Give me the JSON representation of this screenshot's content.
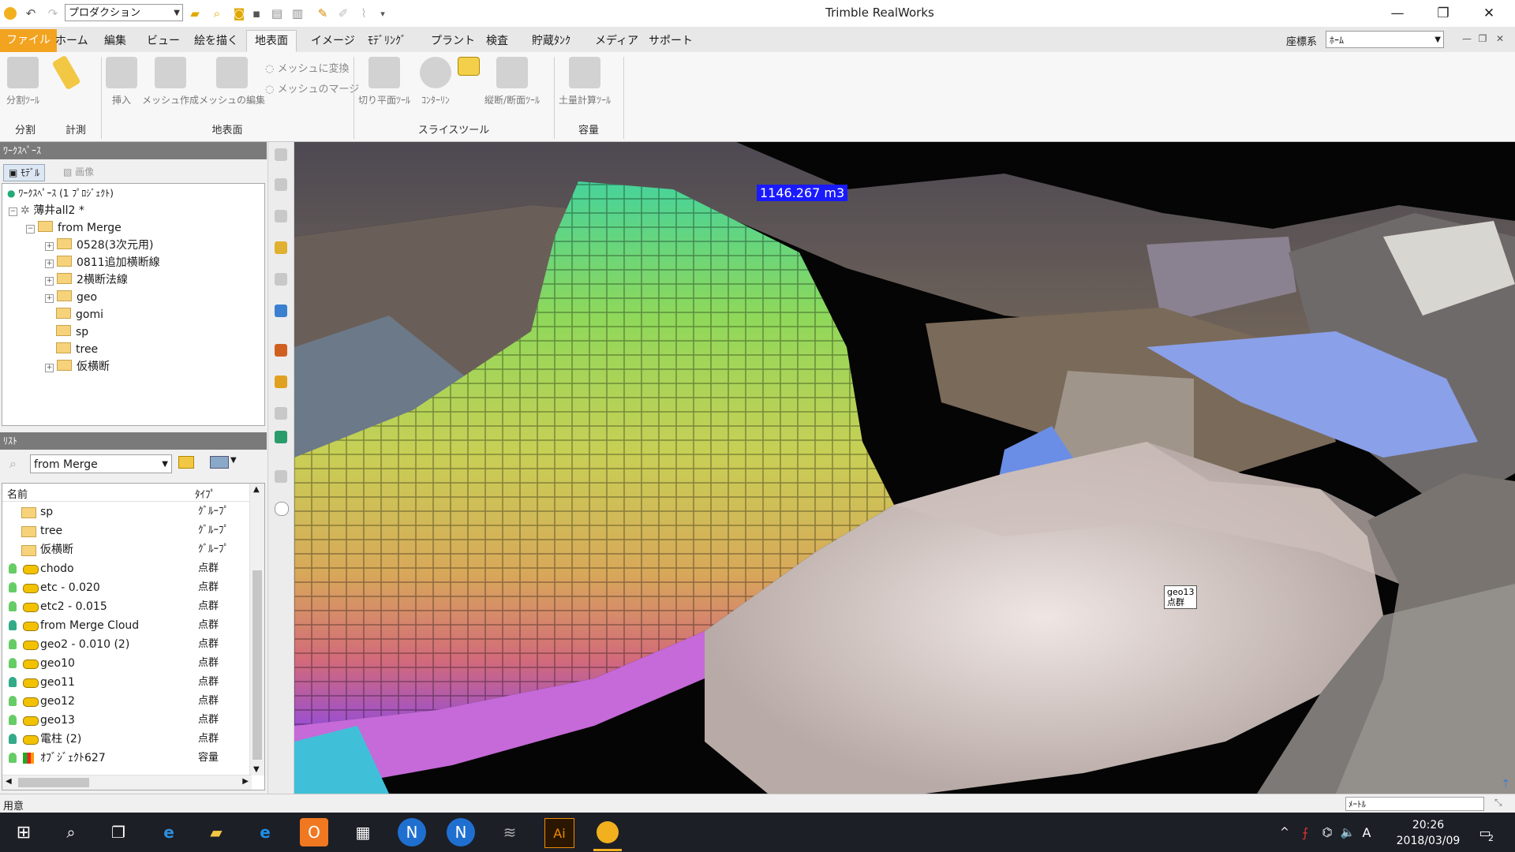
{
  "titlebar": {
    "project": "プロダクション",
    "app_title": "Trimble RealWorks",
    "minimize": "—",
    "restore": "❐",
    "close": "✕"
  },
  "tabs": [
    "ファイル",
    "ホーム",
    "編集",
    "ビュー",
    "絵を描く",
    "地表面",
    "イメージ",
    "ﾓﾃﾞﾘﾝｸﾞ",
    "プラント",
    "検査",
    "貯蔵ﾀﾝｸ",
    "メディア",
    "サポート"
  ],
  "active_tab": "地表面",
  "coord": {
    "label": "座標系",
    "value": "ﾎｰﾑ"
  },
  "ribbon": {
    "split_tool": "分割ﾂｰﾙ",
    "insert": "挿入",
    "mesh_create": "メッシュ作成",
    "mesh_edit": "メッシュの編集",
    "to_mesh": "メッシュに変換",
    "mesh_merge": "メッシュのマージ",
    "cut_plane": "切り平面ﾂｰﾙ",
    "contour": "ｺﾝﾀｰﾘﾝ",
    "section": "縦断/断面ﾂｰﾙ",
    "earthwork": "土量計算ﾂｰﾙ",
    "groups": {
      "split": "分割",
      "measure": "計測",
      "surface": "地表面",
      "slice": "スライスツール",
      "volume": "容量"
    }
  },
  "workspace": {
    "title": "ﾜｰｸｽﾍﾟｰｽ",
    "tab_model": "ﾓﾃﾞﾙ",
    "tab_image": "画像",
    "root": "ﾜｰｸｽﾍﾟｰｽ (1 ﾌﾟﾛｼﾞｪｸﾄ)",
    "project": "薄井all2 *",
    "folder": "from Merge",
    "children": [
      "0528(3次元用)",
      "0811追加横断線",
      "2横断法線",
      "geo",
      "gomi",
      "sp",
      "tree",
      "仮横断"
    ]
  },
  "list": {
    "title": "ﾘｽﾄ",
    "filter": "from Merge",
    "col_name": "名前",
    "col_type": "ﾀｲﾌﾟ",
    "rows": [
      {
        "name": "sp",
        "type": "ｸﾞﾙｰﾌﾟ"
      },
      {
        "name": "tree",
        "type": "ｸﾞﾙｰﾌﾟ"
      },
      {
        "name": "仮横断",
        "type": "ｸﾞﾙｰﾌﾟ"
      },
      {
        "name": "chodo",
        "type": "点群"
      },
      {
        "name": "etc - 0.020",
        "type": "点群"
      },
      {
        "name": "etc2 - 0.015",
        "type": "点群"
      },
      {
        "name": "from Merge Cloud",
        "type": "点群"
      },
      {
        "name": "geo2 - 0.010 (2)",
        "type": "点群"
      },
      {
        "name": "geo10",
        "type": "点群"
      },
      {
        "name": "geo11",
        "type": "点群"
      },
      {
        "name": "geo12",
        "type": "点群"
      },
      {
        "name": "geo13",
        "type": "点群"
      },
      {
        "name": "電柱 (2)",
        "type": "点群"
      },
      {
        "name": "ｵﾌﾞｼﾞｪｸﾄ627",
        "type": "容量"
      }
    ]
  },
  "viewport": {
    "volume_label": "1146.267 m3",
    "geo_tag_name": "geo13",
    "geo_tag_type": "点群"
  },
  "status": {
    "text": "用意",
    "unit": "ﾒｰﾄﾙ"
  },
  "taskbar": {
    "time": "20:26",
    "date": "2018/03/09",
    "ime": "A",
    "notif": "2"
  }
}
